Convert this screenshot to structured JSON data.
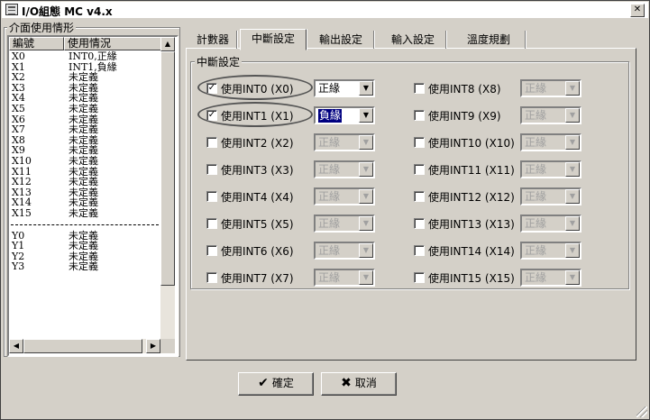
{
  "window": {
    "title": "I/O組態 MC v4.x",
    "close_glyph": "✕"
  },
  "left_panel": {
    "legend": "介面使用情形",
    "headers": [
      "編號",
      "使用情況"
    ],
    "x_rows": [
      {
        "id": "X0",
        "status": "INT0,正緣"
      },
      {
        "id": "X1",
        "status": "INT1,負緣"
      },
      {
        "id": "X2",
        "status": "未定義"
      },
      {
        "id": "X3",
        "status": "未定義"
      },
      {
        "id": "X4",
        "status": "未定義"
      },
      {
        "id": "X5",
        "status": "未定義"
      },
      {
        "id": "X6",
        "status": "未定義"
      },
      {
        "id": "X7",
        "status": "未定義"
      },
      {
        "id": "X8",
        "status": "未定義"
      },
      {
        "id": "X9",
        "status": "未定義"
      },
      {
        "id": "X10",
        "status": "未定義"
      },
      {
        "id": "X11",
        "status": "未定義"
      },
      {
        "id": "X12",
        "status": "未定義"
      },
      {
        "id": "X13",
        "status": "未定義"
      },
      {
        "id": "X14",
        "status": "未定義"
      },
      {
        "id": "X15",
        "status": "未定義"
      }
    ],
    "y_rows": [
      {
        "id": "Y0",
        "status": "未定義"
      },
      {
        "id": "Y1",
        "status": "未定義"
      },
      {
        "id": "Y2",
        "status": "未定義"
      },
      {
        "id": "Y3",
        "status": "未定義"
      }
    ]
  },
  "tabs": [
    {
      "label": "計數器",
      "active": false
    },
    {
      "label": "中斷設定",
      "active": true
    },
    {
      "label": "輸出設定",
      "active": false
    },
    {
      "label": "輸入設定",
      "active": false
    },
    {
      "label": "溫度規劃",
      "active": false
    }
  ],
  "interrupt": {
    "legend": "中斷設定",
    "left_column": [
      {
        "label": "使用INT0 (X0)",
        "checked": true,
        "edge": "正緣",
        "enabled": true,
        "highlight": false
      },
      {
        "label": "使用INT1 (X1)",
        "checked": true,
        "edge": "負緣",
        "enabled": true,
        "highlight": true
      },
      {
        "label": "使用INT2 (X2)",
        "checked": false,
        "edge": "正緣",
        "enabled": false
      },
      {
        "label": "使用INT3 (X3)",
        "checked": false,
        "edge": "正緣",
        "enabled": false
      },
      {
        "label": "使用INT4 (X4)",
        "checked": false,
        "edge": "正緣",
        "enabled": false
      },
      {
        "label": "使用INT5 (X5)",
        "checked": false,
        "edge": "正緣",
        "enabled": false
      },
      {
        "label": "使用INT6 (X6)",
        "checked": false,
        "edge": "正緣",
        "enabled": false
      },
      {
        "label": "使用INT7 (X7)",
        "checked": false,
        "edge": "正緣",
        "enabled": false
      }
    ],
    "right_column": [
      {
        "label": "使用INT8 (X8)",
        "checked": false,
        "edge": "正緣",
        "enabled": false
      },
      {
        "label": "使用INT9 (X9)",
        "checked": false,
        "edge": "正緣",
        "enabled": false
      },
      {
        "label": "使用INT10 (X10)",
        "checked": false,
        "edge": "正緣",
        "enabled": false
      },
      {
        "label": "使用INT11 (X11)",
        "checked": false,
        "edge": "正緣",
        "enabled": false
      },
      {
        "label": "使用INT12 (X12)",
        "checked": false,
        "edge": "正緣",
        "enabled": false
      },
      {
        "label": "使用INT13 (X13)",
        "checked": false,
        "edge": "正緣",
        "enabled": false
      },
      {
        "label": "使用INT14 (X14)",
        "checked": false,
        "edge": "正緣",
        "enabled": false
      },
      {
        "label": "使用INT15 (X15)",
        "checked": false,
        "edge": "正緣",
        "enabled": false
      }
    ]
  },
  "buttons": {
    "ok_label": "確定",
    "ok_icon": "check-icon",
    "cancel_label": "取消",
    "cancel_icon": "x-icon"
  }
}
